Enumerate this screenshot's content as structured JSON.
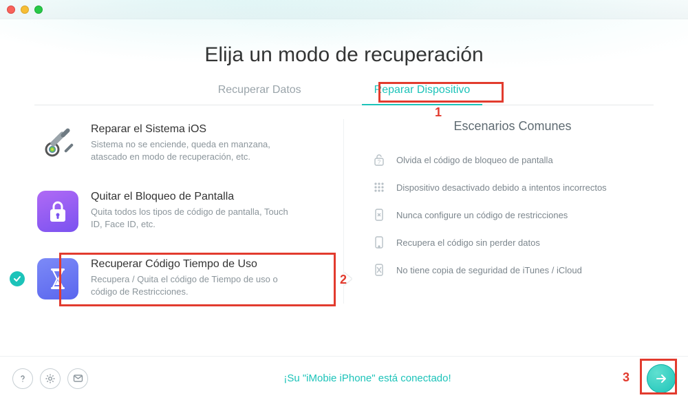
{
  "page_title": "Elija un modo de recuperación",
  "tabs": {
    "recover_data": "Recuperar Datos",
    "repair_device": "Reparar Dispositivo"
  },
  "options": [
    {
      "title": "Reparar el Sistema iOS",
      "desc": "Sistema no se enciende, queda en manzana, atascado en modo de recuperación, etc."
    },
    {
      "title": "Quitar el Bloqueo de Pantalla",
      "desc": "Quita todos los tipos de código de pantalla, Touch ID, Face ID, etc."
    },
    {
      "title": "Recuperar Código Tiempo de Uso",
      "desc": "Recupera / Quita el código de Tiempo de uso o código de Restricciones."
    }
  ],
  "scenarios_title": "Escenarios Comunes",
  "scenarios": [
    "Olvida el código de bloqueo de pantalla",
    "Dispositivo desactivado debido a intentos incorrectos",
    "Nunca configure un código de restricciones",
    "Recupera el código sin perder datos",
    "No tiene copia de seguridad de iTunes / iCloud"
  ],
  "footer_status": "¡Su \"iMobie iPhone\" está conectado!",
  "annotations": {
    "one": "1",
    "two": "2",
    "three": "3"
  }
}
